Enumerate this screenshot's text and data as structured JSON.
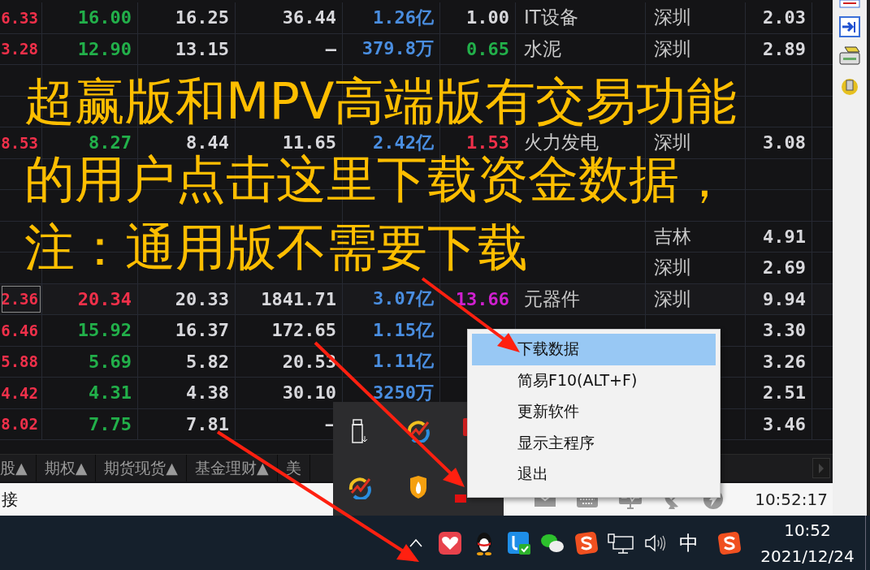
{
  "table": {
    "rows": [
      {
        "selected": false,
        "cells": [
          {
            "text": "6.33",
            "color": "#f0304a"
          },
          {
            "text": "16.00",
            "color": "#22b04a"
          },
          {
            "text": "16.25",
            "color": "#d8d8dc"
          },
          {
            "text": "36.44",
            "color": "#d8d8dc"
          },
          {
            "text": "1.26亿",
            "color": "#4a8ee0"
          },
          {
            "text": "1.00",
            "color": "#d8d8dc"
          },
          {
            "text": "IT设备",
            "color": "#c8c8c8"
          },
          {
            "text": "深圳",
            "color": "#c8c8c8"
          },
          {
            "text": "2.03",
            "color": "#d8d8dc"
          }
        ]
      },
      {
        "selected": false,
        "cells": [
          {
            "text": "3.28",
            "color": "#f0304a"
          },
          {
            "text": "12.90",
            "color": "#22b04a"
          },
          {
            "text": "13.15",
            "color": "#d8d8dc"
          },
          {
            "text": "–",
            "color": "#d8d8dc"
          },
          {
            "text": "379.8万",
            "color": "#4a8ee0"
          },
          {
            "text": "0.65",
            "color": "#22b04a"
          },
          {
            "text": "水泥",
            "color": "#c8c8c8"
          },
          {
            "text": "深圳",
            "color": "#c8c8c8"
          },
          {
            "text": "2.89",
            "color": "#d8d8dc"
          }
        ]
      },
      {
        "selected": false,
        "cells": [
          null,
          null,
          null,
          null,
          null,
          null,
          null,
          null,
          null
        ]
      },
      {
        "selected": false,
        "cells": [
          null,
          null,
          null,
          null,
          null,
          null,
          null,
          null,
          null
        ]
      },
      {
        "selected": false,
        "cells": [
          {
            "text": "8.53",
            "color": "#f0304a"
          },
          {
            "text": "8.27",
            "color": "#22b04a"
          },
          {
            "text": "8.44",
            "color": "#d8d8dc"
          },
          {
            "text": "11.65",
            "color": "#d8d8dc"
          },
          {
            "text": "2.42亿",
            "color": "#4a8ee0"
          },
          {
            "text": "1.53",
            "color": "#f0304a"
          },
          {
            "text": "火力发电",
            "color": "#c8c8c8"
          },
          {
            "text": "深圳",
            "color": "#c8c8c8"
          },
          {
            "text": "3.08",
            "color": "#d8d8dc"
          }
        ]
      },
      {
        "selected": false,
        "cells": [
          null,
          null,
          null,
          null,
          null,
          null,
          null,
          null,
          null
        ]
      },
      {
        "selected": false,
        "cells": [
          null,
          null,
          null,
          null,
          null,
          null,
          null,
          null,
          null
        ]
      },
      {
        "selected": false,
        "cells": [
          null,
          null,
          null,
          null,
          null,
          null,
          null,
          {
            "text": "吉林",
            "color": "#c8c8c8"
          },
          {
            "text": "4.91",
            "color": "#d8d8dc"
          }
        ]
      },
      {
        "selected": false,
        "cells": [
          null,
          null,
          null,
          null,
          null,
          null,
          null,
          {
            "text": "深圳",
            "color": "#c8c8c8"
          },
          {
            "text": "2.69",
            "color": "#d8d8dc"
          }
        ]
      },
      {
        "selected": true,
        "cells": [
          {
            "text": "2.36",
            "color": "#f0304a"
          },
          {
            "text": "20.34",
            "color": "#f0304a"
          },
          {
            "text": "20.33",
            "color": "#d8d8dc"
          },
          {
            "text": "1841.71",
            "color": "#d8d8dc"
          },
          {
            "text": "3.07亿",
            "color": "#4a8ee0"
          },
          {
            "text": "13.66",
            "color": "#d020d0"
          },
          {
            "text": "元器件",
            "color": "#c8c8c8"
          },
          {
            "text": "深圳",
            "color": "#c8c8c8"
          },
          {
            "text": "9.94",
            "color": "#d8d8dc"
          }
        ]
      },
      {
        "selected": false,
        "cells": [
          {
            "text": "6.46",
            "color": "#f0304a"
          },
          {
            "text": "15.92",
            "color": "#22b04a"
          },
          {
            "text": "16.37",
            "color": "#d8d8dc"
          },
          {
            "text": "172.65",
            "color": "#d8d8dc"
          },
          {
            "text": "1.15亿",
            "color": "#4a8ee0"
          },
          null,
          null,
          null,
          {
            "text": "3.30",
            "color": "#d8d8dc"
          }
        ]
      },
      {
        "selected": false,
        "cells": [
          {
            "text": "5.88",
            "color": "#f0304a"
          },
          {
            "text": "5.69",
            "color": "#22b04a"
          },
          {
            "text": "5.82",
            "color": "#d8d8dc"
          },
          {
            "text": "20.53",
            "color": "#d8d8dc"
          },
          {
            "text": "1.11亿",
            "color": "#4a8ee0"
          },
          null,
          null,
          null,
          {
            "text": "3.26",
            "color": "#d8d8dc"
          }
        ]
      },
      {
        "selected": false,
        "cells": [
          {
            "text": "4.42",
            "color": "#f0304a"
          },
          {
            "text": "4.31",
            "color": "#22b04a"
          },
          {
            "text": "4.38",
            "color": "#d8d8dc"
          },
          {
            "text": "30.10",
            "color": "#d8d8dc"
          },
          {
            "text": "3250万",
            "color": "#4a8ee0"
          },
          null,
          null,
          null,
          {
            "text": "2.51",
            "color": "#d8d8dc"
          }
        ]
      },
      {
        "selected": false,
        "cells": [
          {
            "text": "8.02",
            "color": "#f0304a"
          },
          {
            "text": "7.75",
            "color": "#22b04a"
          },
          {
            "text": "7.81",
            "color": "#d8d8dc"
          },
          {
            "text": "–",
            "color": "#d8d8dc"
          },
          null,
          null,
          null,
          null,
          {
            "text": "3.46",
            "color": "#d8d8dc"
          }
        ]
      }
    ]
  },
  "bottom_tabs": [
    {
      "label": "股▲",
      "selected": false
    },
    {
      "label": "期权▲",
      "selected": false
    },
    {
      "label": "期货现货▲",
      "selected": false
    },
    {
      "label": "基金理财▲",
      "selected": false
    },
    {
      "label": "美",
      "selected": false
    }
  ],
  "status_bar": {
    "connection": "接",
    "time": "10:52:17"
  },
  "context_menu": {
    "items": [
      {
        "label": "下载数据",
        "selected": true
      },
      {
        "label": "简易F10(ALT+F)",
        "selected": false
      },
      {
        "label": "更新软件",
        "selected": false
      },
      {
        "label": "显示主程序",
        "selected": false
      },
      {
        "label": "退出",
        "selected": false
      }
    ]
  },
  "annotation": {
    "lines": [
      "超赢版和MPV高端版有交易功能",
      "的用户点击这里下载资金数据，",
      "注：通用版不需要下载"
    ]
  },
  "taskbar": {
    "input_method": "中",
    "time": "10:52",
    "date": "2021/12/24"
  }
}
